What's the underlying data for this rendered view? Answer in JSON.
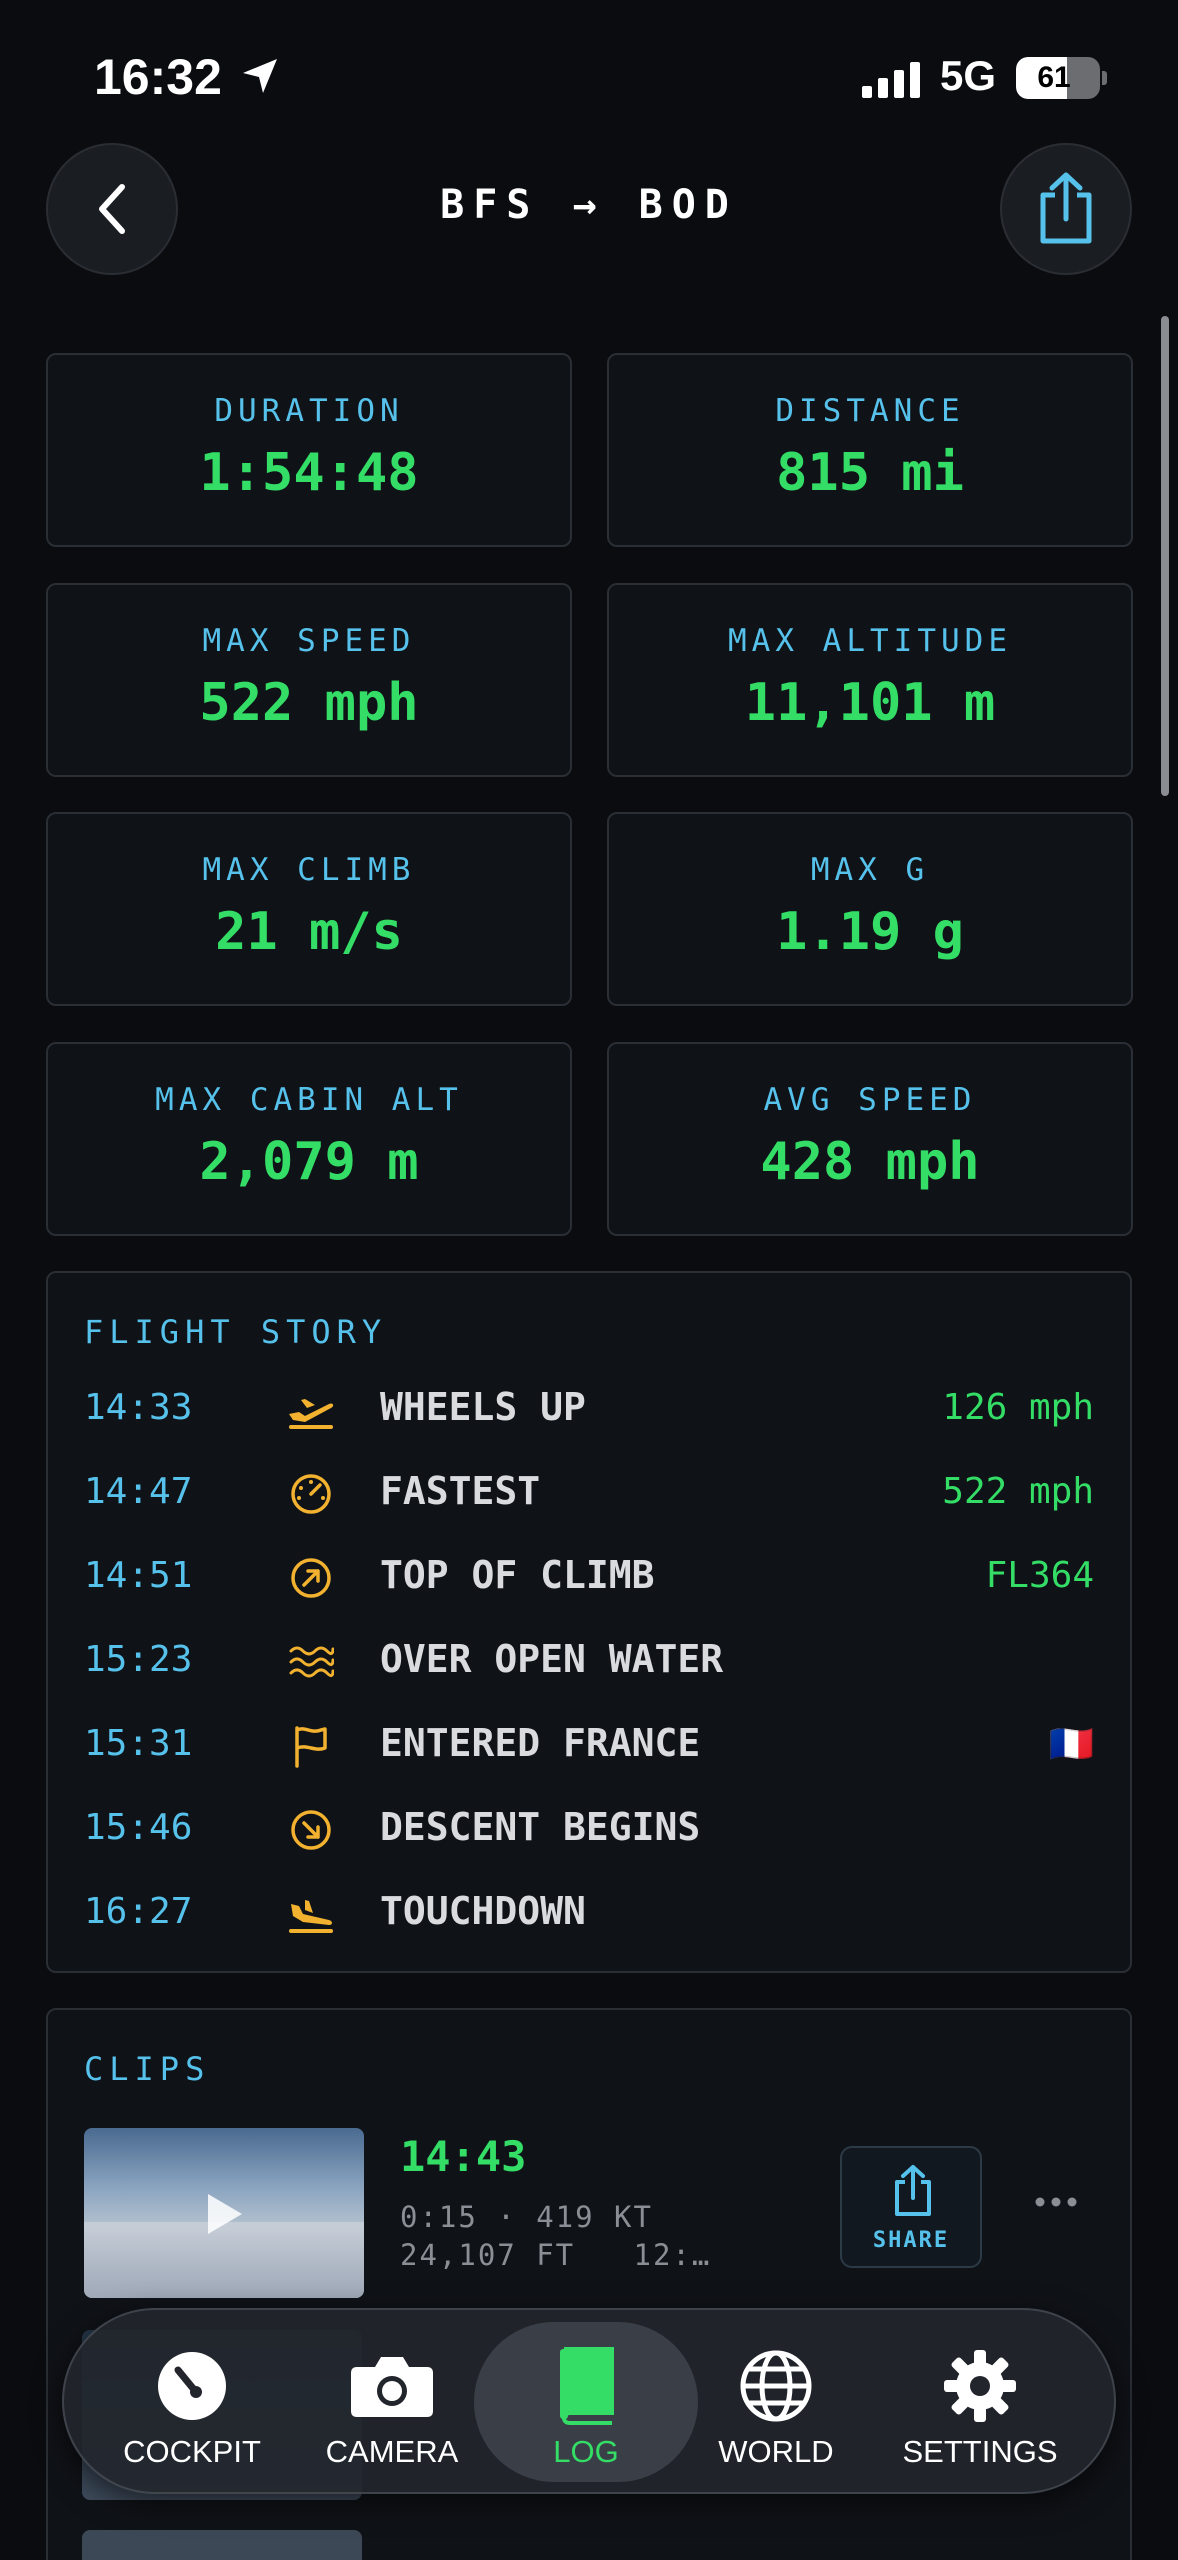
{
  "status_bar": {
    "time": "16:32",
    "network": "5G",
    "battery": 61
  },
  "header": {
    "route": "BFS → BOD"
  },
  "stats": [
    {
      "label": "DURATION",
      "value": "1:54:48"
    },
    {
      "label": "DISTANCE",
      "value": "815 mi"
    },
    {
      "label": "MAX SPEED",
      "value": "522 mph"
    },
    {
      "label": "MAX ALTITUDE",
      "value": "11,101 m"
    },
    {
      "label": "MAX CLIMB",
      "value": "21 m/s"
    },
    {
      "label": "MAX G",
      "value": "1.19 g"
    },
    {
      "label": "MAX CABIN ALT",
      "value": "2,079 m"
    },
    {
      "label": "AVG SPEED",
      "value": "428 mph"
    }
  ],
  "flight_story": {
    "title": "FLIGHT STORY",
    "events": [
      {
        "time": "14:33",
        "icon": "takeoff-icon",
        "event": "WHEELS UP",
        "value": "126 mph"
      },
      {
        "time": "14:47",
        "icon": "speedometer-icon",
        "event": "FASTEST",
        "value": "522 mph"
      },
      {
        "time": "14:51",
        "icon": "arrow-up-right-circle-icon",
        "event": "TOP OF CLIMB",
        "value": "FL364"
      },
      {
        "time": "15:23",
        "icon": "waves-icon",
        "event": "OVER OPEN WATER",
        "value": ""
      },
      {
        "time": "15:31",
        "icon": "flag-icon",
        "event": "ENTERED FRANCE",
        "value": "🇫🇷"
      },
      {
        "time": "15:46",
        "icon": "arrow-down-right-circle-icon",
        "event": "DESCENT BEGINS",
        "value": ""
      },
      {
        "time": "16:27",
        "icon": "landing-icon",
        "event": "TOUCHDOWN",
        "value": ""
      }
    ]
  },
  "clips": {
    "title": "CLIPS",
    "items": [
      {
        "time": "14:43",
        "meta": "0:15 · 419 KT\n24,107 FT   12:…",
        "share_label": "SHARE"
      }
    ]
  },
  "tab_bar": {
    "active": "LOG",
    "tabs": [
      {
        "label": "COCKPIT",
        "icon": "gauge-icon"
      },
      {
        "label": "CAMERA",
        "icon": "camera-icon"
      },
      {
        "label": "LOG",
        "icon": "book-icon"
      },
      {
        "label": "WORLD",
        "icon": "globe-icon"
      },
      {
        "label": "SETTINGS",
        "icon": "gear-icon"
      }
    ]
  },
  "colors": {
    "accent_cyan": "#56c2ec",
    "accent_green": "#33dd66",
    "icon_amber": "#f2b230",
    "background": "#0a0c10"
  }
}
